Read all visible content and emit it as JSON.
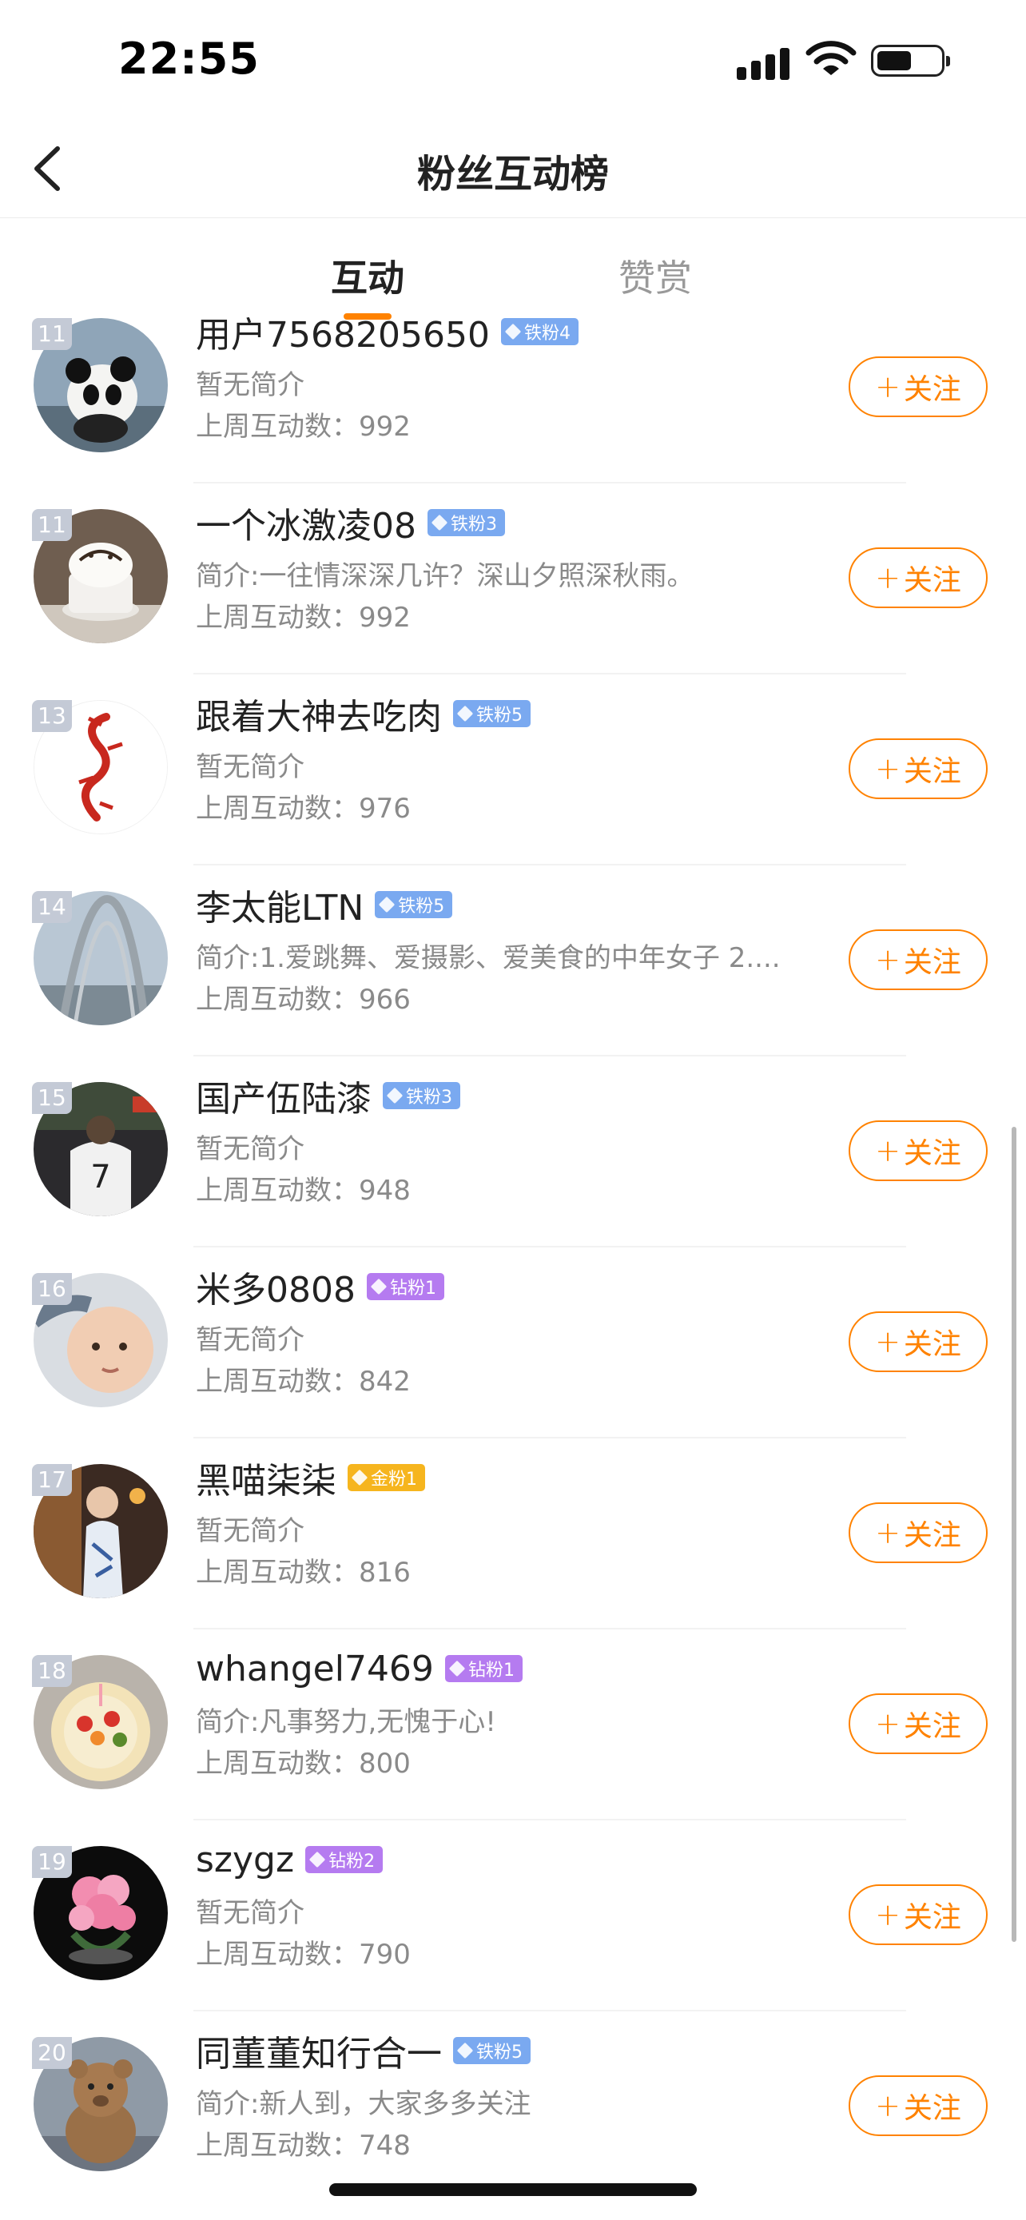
{
  "status_bar": {
    "time": "22:55"
  },
  "nav": {
    "title": "粉丝互动榜"
  },
  "tabs": [
    {
      "label": "互动",
      "active": true
    },
    {
      "label": "赞赏",
      "active": false
    }
  ],
  "follow_label": "关注",
  "fans": [
    {
      "rank": "11",
      "name": "用户7568205650",
      "badge": "铁粉4",
      "badge_type": "iron",
      "intro": "暂无简介",
      "count_label": "上周互动数：992"
    },
    {
      "rank": "11",
      "name": "一个冰激凌08",
      "badge": "铁粉3",
      "badge_type": "iron",
      "intro": "简介:一往情深深几许？深山夕照深秋雨。",
      "count_label": "上周互动数：992"
    },
    {
      "rank": "13",
      "name": "跟着大神去吃肉",
      "badge": "铁粉5",
      "badge_type": "iron",
      "intro": "暂无简介",
      "count_label": "上周互动数：976"
    },
    {
      "rank": "14",
      "name": "李太能LTN",
      "badge": "铁粉5",
      "badge_type": "iron",
      "intro": "简介:1.爱跳舞、爱摄影、爱美食的中年女子 2....",
      "count_label": "上周互动数：966"
    },
    {
      "rank": "15",
      "name": "国产伍陆漆",
      "badge": "铁粉3",
      "badge_type": "iron",
      "intro": "暂无简介",
      "count_label": "上周互动数：948"
    },
    {
      "rank": "16",
      "name": "米多0808",
      "badge": "钻粉1",
      "badge_type": "diamond",
      "intro": "暂无简介",
      "count_label": "上周互动数：842"
    },
    {
      "rank": "17",
      "name": "黑喵柒柒",
      "badge": "金粉1",
      "badge_type": "gold",
      "intro": "暂无简介",
      "count_label": "上周互动数：816"
    },
    {
      "rank": "18",
      "name": "whangel7469",
      "badge": "钻粉1",
      "badge_type": "diamond",
      "intro": "简介:凡事努力,无愧于心!",
      "count_label": "上周互动数：800"
    },
    {
      "rank": "19",
      "name": "szygz",
      "badge": "钻粉2",
      "badge_type": "diamond",
      "intro": "暂无简介",
      "count_label": "上周互动数：790"
    },
    {
      "rank": "20",
      "name": "同董董知行合一",
      "badge": "铁粉5",
      "badge_type": "iron",
      "intro": "简介:新人到，大家多多关注",
      "count_label": "上周互动数：748"
    }
  ],
  "colors": {
    "accent": "#ff8200",
    "iron_badge": "#7aa9f0",
    "diamond_badge": "#b57bf0",
    "gold_badge": "#f6b51e"
  }
}
